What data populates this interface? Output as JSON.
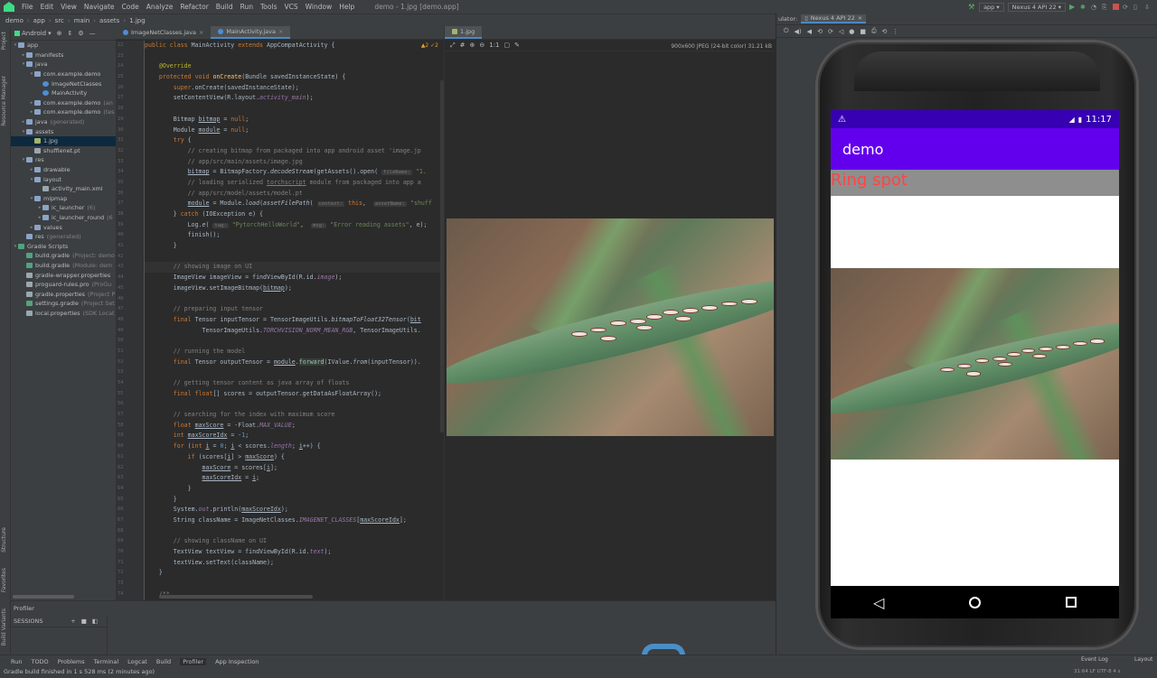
{
  "menubar": {
    "items": [
      "File",
      "Edit",
      "View",
      "Navigate",
      "Code",
      "Analyze",
      "Refactor",
      "Build",
      "Run",
      "Tools",
      "VCS",
      "Window",
      "Help"
    ],
    "window_title": "demo - 1.jpg [demo.app]",
    "run_config": "app",
    "device": "Nexus 4 API 22"
  },
  "breadcrumb": [
    "demo",
    "app",
    "src",
    "main",
    "assets",
    "1.jpg"
  ],
  "left_strip": {
    "project": "Project",
    "resource_manager": "Resource Manager",
    "structure": "Structure",
    "favorites": "Favorites",
    "build_variants": "Build Variants"
  },
  "project": {
    "view_label": "Android",
    "tree": [
      {
        "depth": 0,
        "arrow": "▾",
        "icon": "folder",
        "label": "app",
        "extra": ""
      },
      {
        "depth": 1,
        "arrow": "▸",
        "icon": "folder",
        "label": "manifests",
        "extra": ""
      },
      {
        "depth": 1,
        "arrow": "▾",
        "icon": "folder",
        "label": "java",
        "extra": ""
      },
      {
        "depth": 2,
        "arrow": "▾",
        "icon": "folder",
        "label": "com.example.demo",
        "extra": ""
      },
      {
        "depth": 3,
        "arrow": "",
        "icon": "java",
        "label": "ImageNetClasses",
        "extra": ""
      },
      {
        "depth": 3,
        "arrow": "",
        "icon": "java",
        "label": "MainActivity",
        "extra": ""
      },
      {
        "depth": 2,
        "arrow": "▸",
        "icon": "folder",
        "label": "com.example.demo",
        "extra": "(an"
      },
      {
        "depth": 2,
        "arrow": "▸",
        "icon": "folder",
        "label": "com.example.demo",
        "extra": "(tes"
      },
      {
        "depth": 1,
        "arrow": "▸",
        "icon": "folder",
        "label": "java",
        "extra": "(generated)"
      },
      {
        "depth": 1,
        "arrow": "▾",
        "icon": "folder",
        "label": "assets",
        "extra": ""
      },
      {
        "depth": 2,
        "arrow": "",
        "icon": "img",
        "label": "1.jpg",
        "extra": "",
        "selected": true
      },
      {
        "depth": 2,
        "arrow": "",
        "icon": "doc",
        "label": "shufflenet.pt",
        "extra": ""
      },
      {
        "depth": 1,
        "arrow": "▾",
        "icon": "folder",
        "label": "res",
        "extra": ""
      },
      {
        "depth": 2,
        "arrow": "▸",
        "icon": "folder",
        "label": "drawable",
        "extra": ""
      },
      {
        "depth": 2,
        "arrow": "▾",
        "icon": "folder",
        "label": "layout",
        "extra": ""
      },
      {
        "depth": 3,
        "arrow": "",
        "icon": "doc",
        "label": "activity_main.xml",
        "extra": ""
      },
      {
        "depth": 2,
        "arrow": "▾",
        "icon": "folder",
        "label": "mipmap",
        "extra": ""
      },
      {
        "depth": 3,
        "arrow": "▸",
        "icon": "folder",
        "label": "ic_launcher",
        "extra": "(6)"
      },
      {
        "depth": 3,
        "arrow": "▸",
        "icon": "folder",
        "label": "ic_launcher_round",
        "extra": "(6"
      },
      {
        "depth": 2,
        "arrow": "▸",
        "icon": "folder",
        "label": "values",
        "extra": ""
      },
      {
        "depth": 1,
        "arrow": "",
        "icon": "folder",
        "label": "res",
        "extra": "(generated)"
      },
      {
        "depth": 0,
        "arrow": "▾",
        "icon": "gradle",
        "label": "Gradle Scripts",
        "extra": ""
      },
      {
        "depth": 1,
        "arrow": "",
        "icon": "gradle",
        "label": "build.gradle",
        "extra": "(Project: demo"
      },
      {
        "depth": 1,
        "arrow": "",
        "icon": "gradle",
        "label": "build.gradle",
        "extra": "(Module: dem"
      },
      {
        "depth": 1,
        "arrow": "",
        "icon": "doc",
        "label": "gradle-wrapper.properties",
        "extra": ""
      },
      {
        "depth": 1,
        "arrow": "",
        "icon": "doc",
        "label": "proguard-rules.pro",
        "extra": "(ProGu"
      },
      {
        "depth": 1,
        "arrow": "",
        "icon": "doc",
        "label": "gradle.properties",
        "extra": "(Project P"
      },
      {
        "depth": 1,
        "arrow": "",
        "icon": "gradle",
        "label": "settings.gradle",
        "extra": "(Project Set"
      },
      {
        "depth": 1,
        "arrow": "",
        "icon": "doc",
        "label": "local.properties",
        "extra": "(SDK Locat"
      }
    ]
  },
  "editor": {
    "tabs": [
      {
        "label": "ImageNetClasses.java",
        "active": false
      },
      {
        "label": "MainActivity.java",
        "active": true
      }
    ],
    "inspection": "▲2 ✓2",
    "lines": [
      {
        "n": "22",
        "html": "<span class=\"kw\">public class</span> MainActivity <span class=\"kw\">extends</span> AppCompatActivity {"
      },
      {
        "n": "23",
        "html": ""
      },
      {
        "n": "24",
        "html": "    <span class=\"an\">@Override</span>"
      },
      {
        "n": "25",
        "html": "    <span class=\"kw\">protected void</span> <span class=\"fn\">onCreate</span>(Bundle savedInstanceState) {"
      },
      {
        "n": "26",
        "html": "        <span class=\"kw\">super</span>.onCreate(savedInstanceState);"
      },
      {
        "n": "27",
        "html": "        setContentView(R.layout.<span class=\"it\">activity_main</span>);"
      },
      {
        "n": "28",
        "html": ""
      },
      {
        "n": "29",
        "html": "        Bitmap <span class=\"ul\">bitmap</span> = <span class=\"kw\">null</span>;"
      },
      {
        "n": "30",
        "html": "        Module <span class=\"ul\">module</span> = <span class=\"kw\">null</span>;"
      },
      {
        "n": "31",
        "html": "        <span class=\"kw\">try</span> {"
      },
      {
        "n": "32",
        "html": "            <span class=\"cm\">// creating bitmap from packaged into app android asset 'image.jp</span>"
      },
      {
        "n": "33",
        "html": "            <span class=\"cm\">// app/src/main/assets/image.jpg</span>"
      },
      {
        "n": "34",
        "html": "            <span class=\"ul\">bitmap</span> = BitmapFactory.<span class=\"it\" style=\"color:#a9b7c6\">decodeStream</span>(getAssets().open( <span class=\"hint\">fileName:</span> <span class=\"st\">\"1.</span>"
      },
      {
        "n": "35",
        "html": "            <span class=\"cm\">// loading serialized <span class=\"ul\">torchscript</span> module from packaged into app a</span>"
      },
      {
        "n": "36",
        "html": "            <span class=\"cm\">// app/src/model/assets/model.pt</span>"
      },
      {
        "n": "37",
        "html": "            <span class=\"ul\">module</span> = Module.<span class=\"it\" style=\"color:#a9b7c6\">load</span>(<span class=\"it\" style=\"color:#a9b7c6\">assetFilePath</span>( <span class=\"hint\">context:</span> <span class=\"kw\">this</span>,  <span class=\"hint\">assetName:</span> <span class=\"st\">\"shuff</span>"
      },
      {
        "n": "38",
        "html": "        } <span class=\"kw\">catch</span> (IOException e) {"
      },
      {
        "n": "39",
        "html": "            Log.<span class=\"it\" style=\"color:#a9b7c6\">e</span>( <span class=\"hint\">tag:</span> <span class=\"st\">\"PytorchHelloWorld\"</span>,  <span class=\"hint\">msg:</span> <span class=\"st\">\"Error reading assets\"</span>, e);"
      },
      {
        "n": "40",
        "html": "            finish();"
      },
      {
        "n": "41",
        "html": "        }"
      },
      {
        "n": "42",
        "html": ""
      },
      {
        "n": "43",
        "html": "        <span class=\"cm\">// showing image on UI</span>",
        "hl": true
      },
      {
        "n": "44",
        "html": "        ImageView imageView = findViewById(R.id.<span class=\"it\">image</span>);"
      },
      {
        "n": "45",
        "html": "        imageView.setImageBitmap(<span class=\"ul\">bitmap</span>);"
      },
      {
        "n": "46",
        "html": ""
      },
      {
        "n": "47",
        "html": "        <span class=\"cm\">// preparing input tensor</span>"
      },
      {
        "n": "48",
        "html": "        <span class=\"kw\">final</span> Tensor inputTensor = TensorImageUtils.<span class=\"it\" style=\"color:#a9b7c6\">bitmapToFloat32Tensor</span>(<span class=\"ul\">bit</span>"
      },
      {
        "n": "49",
        "html": "                TensorImageUtils.<span class=\"it\">TORCHVISION_NORM_MEAN_RGB</span>, TensorImageUtils."
      },
      {
        "n": "50",
        "html": ""
      },
      {
        "n": "51",
        "html": "        <span class=\"cm\">// running the model</span>"
      },
      {
        "n": "52",
        "html": "        <span class=\"kw\">final</span> Tensor outputTensor = <span class=\"ul\">module</span>.<span style=\"background:#344134\">forward</span>(IValue.<span class=\"it\" style=\"color:#a9b7c6\">from</span>(inputTensor))."
      },
      {
        "n": "53",
        "html": ""
      },
      {
        "n": "54",
        "html": "        <span class=\"cm\">// getting tensor content as java array of floats</span>"
      },
      {
        "n": "55",
        "html": "        <span class=\"kw\">final float</span>[] scores = outputTensor.getDataAsFloatArray();"
      },
      {
        "n": "56",
        "html": ""
      },
      {
        "n": "57",
        "html": "        <span class=\"cm\">// searching for the index with maximum score</span>"
      },
      {
        "n": "58",
        "html": "        <span class=\"kw\">float</span> <span class=\"ul\">maxScore</span> = -Float.<span class=\"it\">MAX_VALUE</span>;"
      },
      {
        "n": "59",
        "html": "        <span class=\"kw\">int</span> <span class=\"ul\">maxScoreIdx</span> = -<span style=\"color:#6897bb\">1</span>;"
      },
      {
        "n": "60",
        "html": "        <span class=\"kw\">for</span> (<span class=\"kw\">int</span> <span class=\"ul\">i</span> = <span style=\"color:#6897bb\">0</span>; <span class=\"ul\">i</span> &lt; scores.<span class=\"it\">length</span>; <span class=\"ul\">i</span>++) {"
      },
      {
        "n": "61",
        "html": "            <span class=\"kw\">if</span> (scores[<span class=\"ul\">i</span>] &gt; <span class=\"ul\">maxScore</span>) {"
      },
      {
        "n": "62",
        "html": "                <span class=\"ul\">maxScore</span> = scores[<span class=\"ul\">i</span>];"
      },
      {
        "n": "63",
        "html": "                <span class=\"ul\">maxScoreIdx</span> = <span class=\"ul\">i</span>;"
      },
      {
        "n": "64",
        "html": "            }"
      },
      {
        "n": "65",
        "html": "        }"
      },
      {
        "n": "66",
        "html": "        System.<span class=\"it\">out</span>.println(<span class=\"ul\">maxScoreIdx</span>);"
      },
      {
        "n": "67",
        "html": "        String className = ImageNetClasses.<span class=\"it\">IMAGENET_CLASSES</span>[<span class=\"ul\">maxScoreIdx</span>];"
      },
      {
        "n": "68",
        "html": ""
      },
      {
        "n": "69",
        "html": "        <span class=\"cm\">// showing className on UI</span>"
      },
      {
        "n": "70",
        "html": "        TextView textView = findViewById(R.id.<span class=\"it\">text</span>);"
      },
      {
        "n": "71",
        "html": "        textView.setText(className);"
      },
      {
        "n": "72",
        "html": "    }"
      },
      {
        "n": "73",
        "html": ""
      },
      {
        "n": "74",
        "html": "    <span class=\"cm\">/**</span>"
      }
    ]
  },
  "image_viewer": {
    "tab_label": "1.jpg",
    "info": "900x600 JPEG (24-bit color) 31.21 kB",
    "zoom_label": "1:1"
  },
  "bottom_panel": {
    "title": "Profiler",
    "sessions_label": "SESSIONS"
  },
  "tool_windows": [
    "Run",
    "TODO",
    "Problems",
    "Terminal",
    "Logcat",
    "Build",
    "Profiler",
    "App Inspection"
  ],
  "status": {
    "message": "Gradle build finished in 1 s 528 ms (2 minutes ago)",
    "event_log": "Event Log",
    "layout": "Layout",
    "position": "31:64  LF  UTF-8  4 s"
  },
  "emulator": {
    "label": "ulator:",
    "device_tab": "Nexus 4 API 22",
    "time": "11:17",
    "app_title": "demo",
    "result": "Ring spot"
  }
}
